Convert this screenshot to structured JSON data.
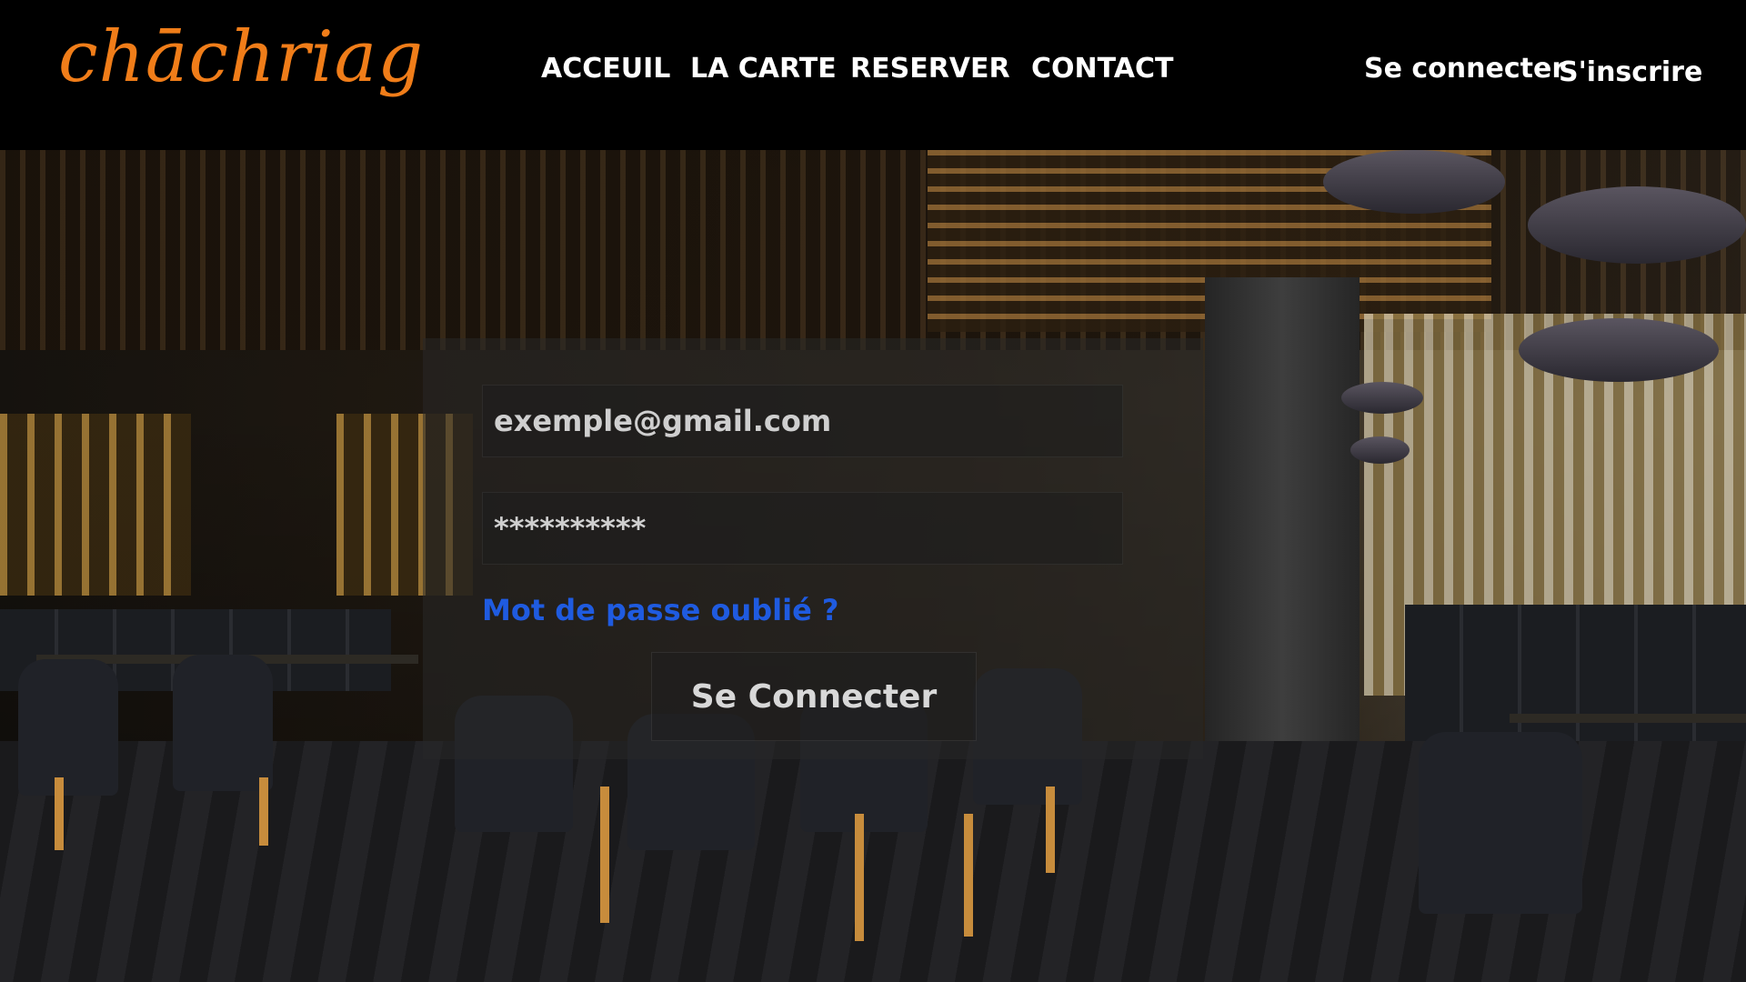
{
  "header": {
    "logo_text": "chāchriag",
    "nav": [
      {
        "label": "ACCEUIL"
      },
      {
        "label": "LA CARTE"
      },
      {
        "label": "RESERVER"
      },
      {
        "label": "CONTACT"
      }
    ],
    "login_link": "Se connecter",
    "signup_link": "S'inscrire"
  },
  "login_form": {
    "email_value": "exemple@gmail.com",
    "password_value": "**********",
    "forgot_password": "Mot de passe oublié ?",
    "submit_label": "Se Connecter"
  },
  "colors": {
    "logo": "#f07d19",
    "link": "#1f5be0",
    "header_bg": "#000000",
    "text": "#ffffff"
  }
}
